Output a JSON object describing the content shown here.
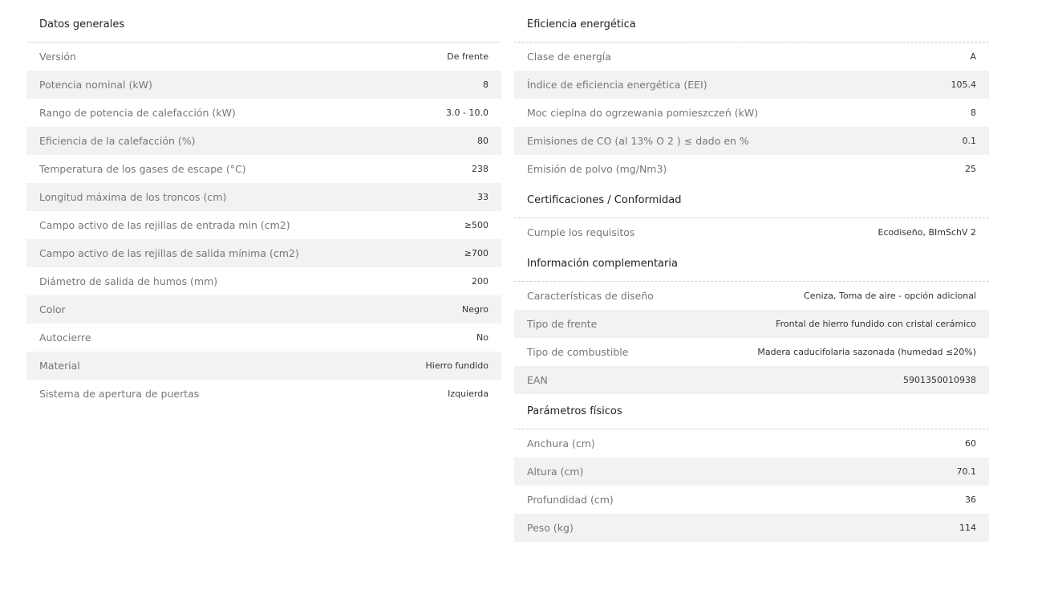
{
  "general": {
    "title": "Datos generales",
    "rows": [
      {
        "label": "Versión",
        "value": "De frente"
      },
      {
        "label": "Potencia nominal (kW)",
        "value": "8"
      },
      {
        "label": "Rango de potencia de calefacción (kW)",
        "value": "3.0 - 10.0"
      },
      {
        "label": "Eficiencia de la calefacción (%)",
        "value": "80"
      },
      {
        "label": "Temperatura de los gases de escape (°C)",
        "value": "238"
      },
      {
        "label": "Longitud máxima de los troncos (cm)",
        "value": "33"
      },
      {
        "label": "Campo activo de las rejillas de entrada min (cm2)",
        "value": "≥500"
      },
      {
        "label": "Campo activo de las rejillas de salida mínima (cm2)",
        "value": "≥700"
      },
      {
        "label": "Diámetro de salida de humos (mm)",
        "value": "200"
      },
      {
        "label": "Color",
        "value": "Negro"
      },
      {
        "label": "Autocierre",
        "value": "No"
      },
      {
        "label": "Material",
        "value": "Hierro fundido"
      },
      {
        "label": "Sistema de apertura de puertas",
        "value": "Izquierda"
      }
    ]
  },
  "energy": {
    "title": "Eficiencia energética",
    "rows": [
      {
        "label": "Clase de energía",
        "value": "A"
      },
      {
        "label": "Índice de eficiencia energética (EEI)",
        "value": "105.4"
      },
      {
        "label": "Moc cieplna do ogrzewania pomieszczeń (kW)",
        "value": "8"
      },
      {
        "label": "Emisiones de CO (al 13% O 2 ) ≤ dado en %",
        "value": "0.1"
      },
      {
        "label": "Emisión de polvo (mg/Nm3)",
        "value": "25"
      }
    ]
  },
  "certifications": {
    "title": "Certificaciones / Conformidad",
    "rows": [
      {
        "label": "Cumple los requisitos",
        "value": "Ecodiseño, BImSchV 2"
      }
    ]
  },
  "additional": {
    "title": "Información complementaria",
    "rows": [
      {
        "label": "Características de diseño",
        "value": "Ceniza, Toma de aire - opción adicional"
      },
      {
        "label": "Tipo de frente",
        "value": "Frontal de hierro fundido con cristal cerámico"
      },
      {
        "label": "Tipo de combustible",
        "value": "Madera caducifolaria sazonada (humedad ≤20%)"
      },
      {
        "label": "EAN",
        "value": "5901350010938"
      }
    ]
  },
  "physical": {
    "title": "Parámetros físicos",
    "rows": [
      {
        "label": "Anchura (cm)",
        "value": "60"
      },
      {
        "label": "Altura (cm)",
        "value": "70.1"
      },
      {
        "label": "Profundidad (cm)",
        "value": "36"
      },
      {
        "label": "Peso (kg)",
        "value": "114"
      }
    ]
  }
}
